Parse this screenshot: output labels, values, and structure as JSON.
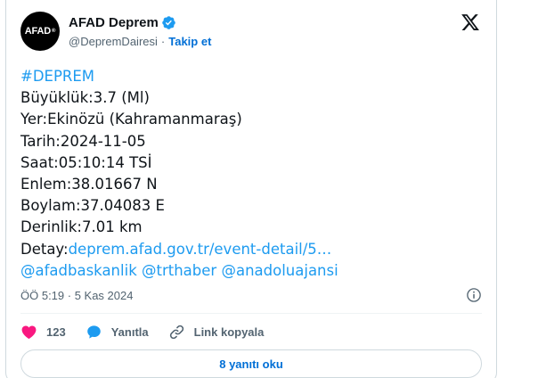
{
  "author": {
    "avatar_text": "AFAD",
    "avatar_mark": "®",
    "display_name": "AFAD Deprem",
    "handle": "@DepremDairesi",
    "separator": "·",
    "follow_label": "Takip et"
  },
  "tweet": {
    "hashtag": "#DEPREM",
    "lines": [
      "Büyüklük:3.7 (Ml)",
      "Yer:Ekinözü (Kahramanmaraş)",
      "Tarih:2024-11-05",
      "Saat:05:10:14 TSİ",
      "Enlem:38.01667 N",
      "Boylam:37.04083 E",
      "Derinlik:7.01 km"
    ],
    "detail_prefix": "Detay:",
    "detail_link": "deprem.afad.gov.tr/event-detail/5…",
    "mentions": [
      "@afadbaskanlik",
      "@trthaber",
      "@anadoluajansi"
    ]
  },
  "meta": {
    "timestamp": "ÖÖ 5:19 · 5 Kas 2024"
  },
  "actions": {
    "like_count": "123",
    "reply_label": "Yanıtla",
    "copy_link_label": "Link kopyala"
  },
  "read_replies_label": "8 yanıtı oku",
  "colors": {
    "link": "#1d9bf0",
    "follow": "#006fd6",
    "like": "#f91880",
    "reply": "#1d9bf0",
    "verified": "#1d9bf0"
  }
}
